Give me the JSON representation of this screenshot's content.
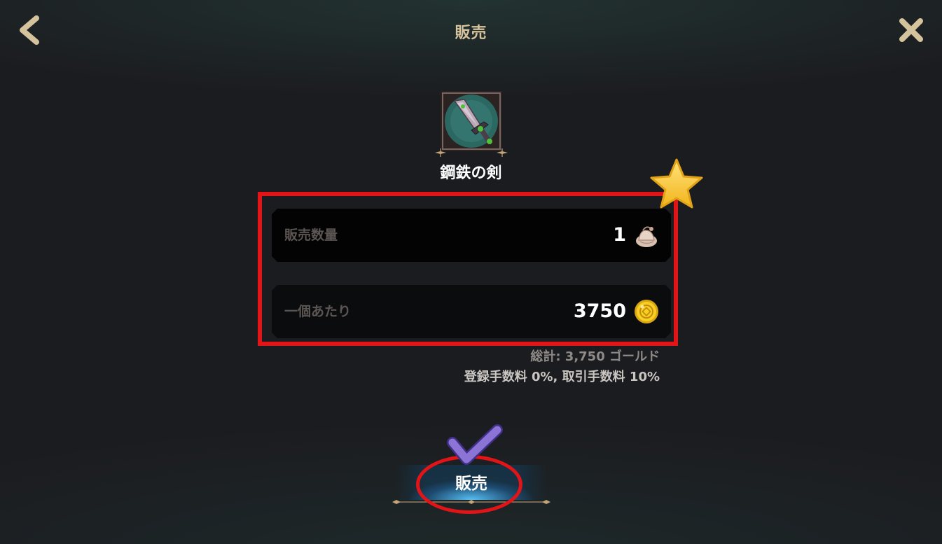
{
  "header": {
    "title": "販売",
    "back_icon": "chevron-left-icon",
    "close_icon": "close-x-icon",
    "accent_color": "#d5c39e"
  },
  "item": {
    "name": "鋼鉄の剣",
    "icon": "steel-sword-icon"
  },
  "quantity_row": {
    "label": "販売数量",
    "value": "1",
    "icon": "item-pouch-icon"
  },
  "price_row": {
    "label": "一個あたり",
    "value": "3750",
    "icon": "gold-coin-icon"
  },
  "summary": {
    "total": "総計: 3,750 ゴールド",
    "fees": "登録手数料 0%, 取引手数料 10%"
  },
  "sell_button": {
    "label": "販売"
  },
  "annotations": {
    "highlight_color": "#e11418",
    "star_icon": "star-icon",
    "check_icon": "checkmark-icon"
  }
}
